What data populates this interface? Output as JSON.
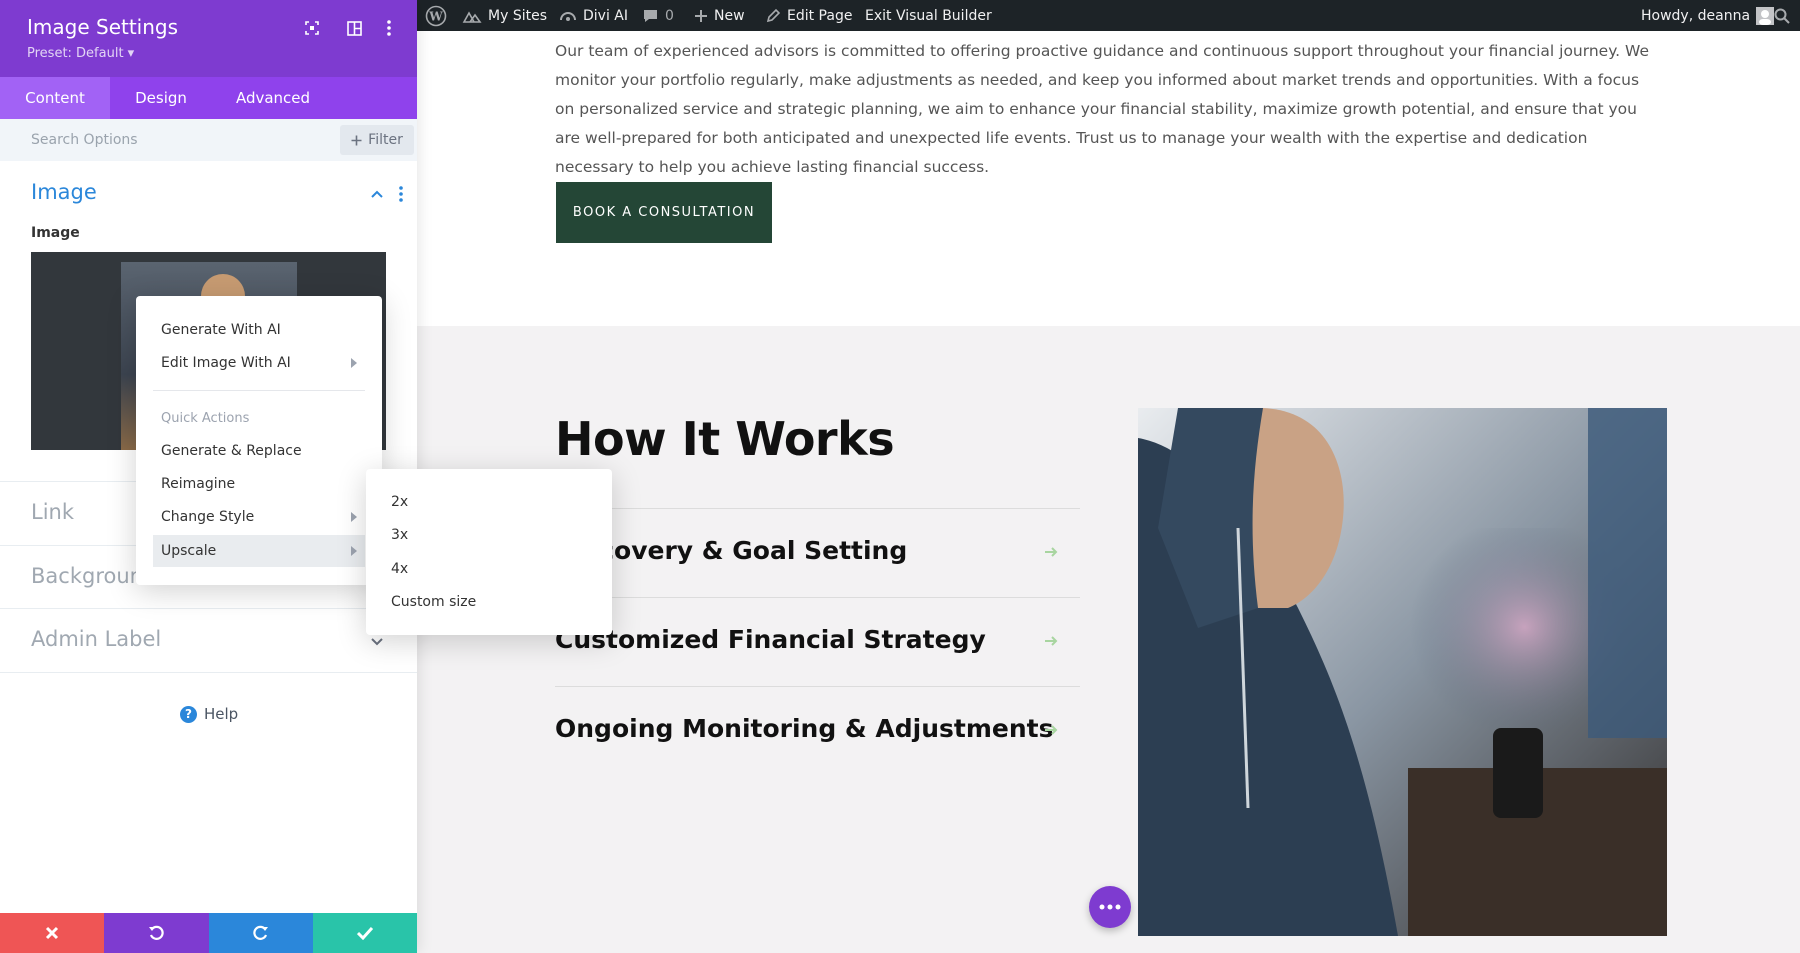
{
  "admin_bar": {
    "my_sites": "My Sites",
    "divi_ai": "Divi AI",
    "comments_count": "0",
    "new": "New",
    "edit_page": "Edit Page",
    "exit_builder": "Exit Visual Builder",
    "howdy": "Howdy, deanna"
  },
  "panel": {
    "title": "Image Settings",
    "preset": "Preset: Default ▾",
    "tabs": [
      {
        "label": "Content"
      },
      {
        "label": "Design"
      },
      {
        "label": "Advanced"
      }
    ],
    "search_placeholder": "Search Options",
    "filter_label": "Filter",
    "image_section_title": "Image",
    "image_field_label": "Image",
    "sections": [
      {
        "label": "Link"
      },
      {
        "label": "Background"
      },
      {
        "label": "Admin Label"
      }
    ],
    "help_label": "Help"
  },
  "context_menu": {
    "generate_with_ai": "Generate With AI",
    "edit_image_with_ai": "Edit Image With AI",
    "quick_actions": "Quick Actions",
    "generate_replace": "Generate & Replace",
    "reimagine": "Reimagine",
    "change_style": "Change Style",
    "upscale": "Upscale"
  },
  "submenu": {
    "items": [
      "2x",
      "3x",
      "4x",
      "Custom size"
    ]
  },
  "content": {
    "intro": "Our team of experienced advisors is committed to offering proactive guidance and continuous support throughout your financial journey. We monitor your portfolio regularly, make adjustments as needed, and keep you informed about market trends and opportunities. With a focus on personalized service and strategic planning, we aim to enhance your financial stability, maximize growth potential, and ensure that you are well-prepared for both anticipated and unexpected life events. Trust us to manage your wealth with the expertise and dedication necessary to help you achieve lasting financial success.",
    "cta": "BOOK A CONSULTATION",
    "how_title": "How It Works",
    "steps": [
      {
        "title": "Discovery & Goal Setting"
      },
      {
        "title": "Customized Financial Strategy"
      },
      {
        "title": "Ongoing Monitoring & Adjustments"
      }
    ]
  },
  "colors": {
    "panel_purple": "#7e3bd0",
    "tab_purple": "#8f42ec",
    "accent_blue": "#2b87da",
    "cta_green": "#244636",
    "cancel_red": "#ef5555",
    "save_teal": "#29c4a9"
  }
}
